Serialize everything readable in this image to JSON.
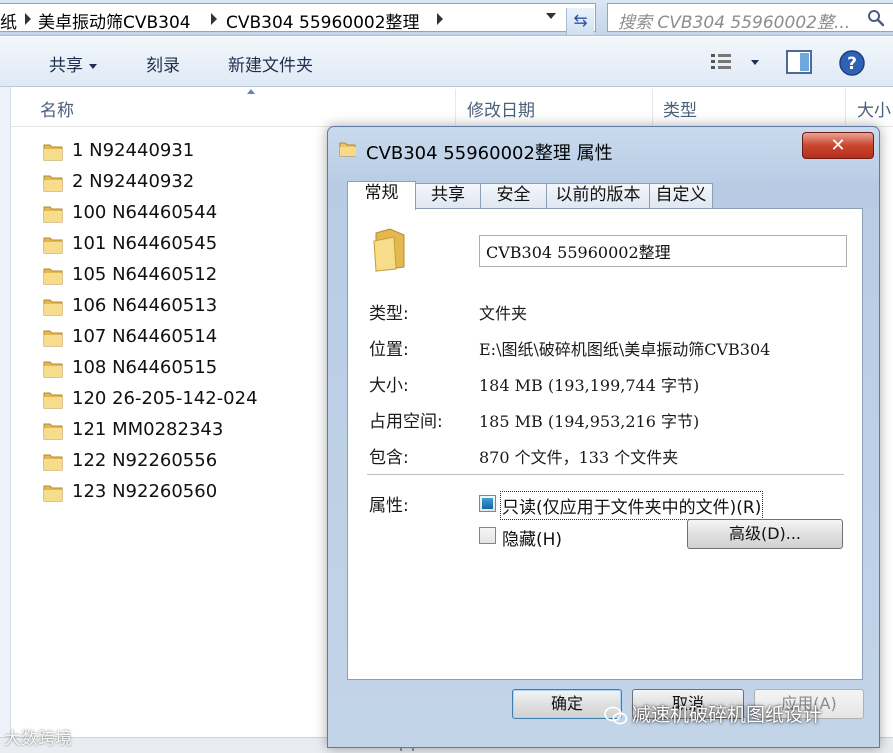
{
  "address": {
    "crumbs": [
      "纸",
      "美卓振动筛CVB304",
      "CVB304 55960002整理"
    ],
    "search_placeholder": "搜索 CVB304 55960002整..."
  },
  "toolbar": {
    "share_label": "共享",
    "burn_label": "刻录",
    "new_folder_label": "新建文件夹"
  },
  "columns": {
    "name": "名称",
    "modified": "修改日期",
    "type": "类型",
    "size": "大小"
  },
  "files": [
    "1  N92440931",
    "2  N92440932",
    "100  N64460544",
    "101  N64460545",
    "105  N64460512",
    "106  N64460513",
    "107  N64460514",
    "108  N64460515",
    "120  26-205-142-024",
    "121  MM0282343",
    "122  N92260556",
    "123  N92260560"
  ],
  "dialog": {
    "title": "CVB304 55960002整理 属性",
    "close_label": "✕",
    "tabs": [
      "常规",
      "共享",
      "安全",
      "以前的版本",
      "自定义"
    ],
    "active_tab": "常规",
    "folder_name": "CVB304 55960002整理",
    "props": {
      "type_label": "类型:",
      "type_value": "文件夹",
      "location_label": "位置:",
      "location_value": "E:\\图纸\\破碎机图纸\\美卓振动筛CVB304",
      "size_label": "大小:",
      "size_value": "184 MB (193,199,744 字节)",
      "disk_label": "占用空间:",
      "disk_value": "185 MB (194,953,216 字节)",
      "contains_label": "包含:",
      "contains_value": "870 个文件，133 个文件夹"
    },
    "attributes": {
      "label": "属性:",
      "readonly_label": "只读(仅应用于文件夹中的文件)(R)",
      "hidden_label": "隐藏(H)",
      "advanced_label": "高级(D)..."
    },
    "buttons": {
      "ok": "确定",
      "cancel": "取消",
      "apply": "应用(A)"
    }
  },
  "watermarks": {
    "left": "大数跨境",
    "right": "减速机破碎机图纸设计"
  }
}
